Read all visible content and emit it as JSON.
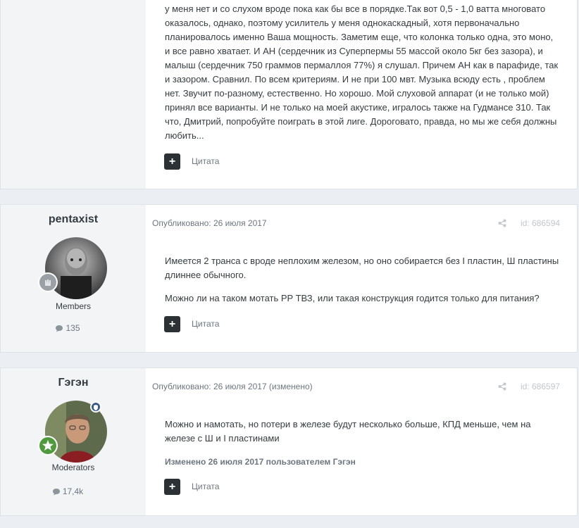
{
  "posts": [
    {
      "body": "у меня нет и со слухом вроде пока как бы все в порядке.Так вот 0,5 - 1,0 ватта многовато оказалось, однако, поэтому усилитель у меня однокаскадный, хотя первоначально планировалось именно Ваша мощность. Заметим еще, что колонка только одна, это моно, и все равно хватает. И АН (сердечник из Суперпермы 55 массой около 5кг без зазора), и малыш (сердечник 750 граммов пермаллоя 77%) я слушал. Причем АН как в парафиде, так и зазором. Сравнил. По всем критериям. И не при 100 мвт. Музыка всюду есть , проблем нет. Звучит по-разному, естественно. Но хорошо. Мой слуховой аппарат (и не только мой) принял все варианты. И не только на моей акустике, игралось также на Гудмансе 310. Так что, Дмитрий, попробуйте поиграть в этой лиге. Дороговато, правда, но мы же себя должны любить...",
      "quote_icon": "plus-icon",
      "quote_label": "Цитата"
    },
    {
      "author": "pentaxist",
      "group": "Members",
      "post_count": "135",
      "meta": "Опубликовано: 26 июля 2017",
      "id": "id: 686594",
      "paragraphs": [
        "Имеется 2 транса с вроде неплохим железом, но оно собирается без I пластин, Ш пластины длиннее обычного.",
        "Можно ли на таком мотать PP ТВЗ, или такая конструкция годится только для питания?"
      ],
      "quote_label": "Цитата"
    },
    {
      "author": "Гэгэн",
      "group": "Moderators",
      "post_count": "17,4k",
      "meta": "Опубликовано: 26 июля 2017 (изменено)",
      "id": "id: 686597",
      "paragraphs": [
        "Можно и намотать, но потери в железе будут несколько больше, КПД меньше, чем на железе с Ш и I пластинами"
      ],
      "edited": "Изменено 26 июля 2017 пользователем Гэгэн",
      "quote_label": "Цитата"
    }
  ],
  "colors": {
    "page_bg": "#ebeef2",
    "author_panel_bg": "#f3f4f6",
    "quote_button": "#2c3135",
    "muted_text": "#6d7680",
    "moderator_badge": "#3a5b8f",
    "rank_badge_green": "#4f9a3c"
  }
}
